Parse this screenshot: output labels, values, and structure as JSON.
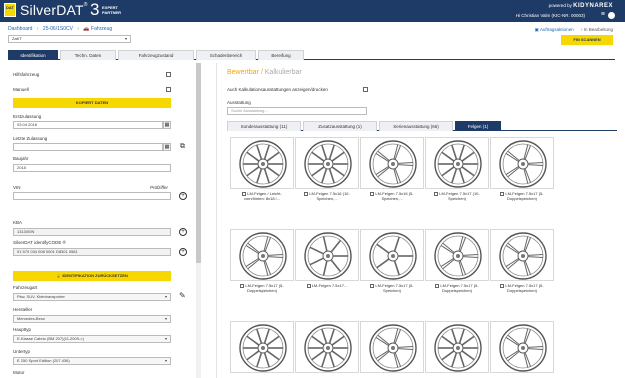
{
  "header": {
    "brand": "SilverDAT",
    "brand_reg": "®",
    "version": "3",
    "expert_line1": "EXPERT",
    "expert_line2": "PARTNER",
    "logo_text": "DAT",
    "powered_by": "powered by",
    "powered_brand": "KIDYNAREX",
    "user": "Hi Christian Valm (KIC-NR. 00003)"
  },
  "breadcrumb": {
    "items": [
      "Dashboard",
      "25-06/1S0CV",
      "Fahrzeug"
    ]
  },
  "actions": {
    "orders": "Auftragsaktionen",
    "state": "In Bearbeitung",
    "scan_button": "FIN SCANNEN"
  },
  "top_select": {
    "value": "ZaKT"
  },
  "tabs": [
    "Identifikation",
    "Techn. Daten",
    "Fahrzeugzustand",
    "Schadenbereich",
    "Bereifung"
  ],
  "left": {
    "hilfsfahrzeug": "Hilfsfahrzeug",
    "manuell": "Manuell",
    "kopiert_button": "KOPIERT DATEN",
    "erstzulassung_label": "Erstzulassung",
    "erstzulassung_value": "03.04.2018",
    "letzte_label": "Letzte Zulassung",
    "letzte_value": "",
    "baujahr_label": "Baujahr",
    "baujahr_value": "2018",
    "vin_label": "VIN",
    "pruefziffer_label": "Prüfziffer",
    "kba_label": "KBA",
    "kba_value": "1313/00N",
    "silverdat_label": "SilverDAT identifyCODE ®",
    "silverdat_value": "01 570 034 008 0001 D8301 0581",
    "ident_button": "IDENTIFIKATION ZURÜCKSETZEN",
    "fahrzeugart_label": "Fahrzeugart",
    "fahrzeugart_value": "Pkw, SUV, Kleintransporter",
    "hersteller_label": "Hersteller",
    "hersteller_value": "Mercedes-Benz",
    "haupttyp_label": "Haupttyp",
    "haupttyp_value": "E-Klasse Cabrio (BM 207)(11.2009->)",
    "untertyp_label": "Untertyp",
    "untertyp_value": "E 250 Sport Edition (207.436)",
    "motor_label": "Motor"
  },
  "right": {
    "title_active": "Bewertbar",
    "title_sep": "/",
    "title_inactive": "Kalkulierbar",
    "all_equip_label": "Auch Kalkulationsausstattungen anzeigen/drucken",
    "ausstattung_label": "Ausstattung",
    "search_placeholder": "Suche Ausstattung...",
    "subtabs": [
      "Sonderausstattung (11)",
      "Zusatzausstattung (1)",
      "Serienausstattung (66)",
      "Felgen (1)"
    ],
    "wheels": [
      {
        "label": "LM-Felgen / Leicht-",
        "label2": "vorn/hinten: 8x18 /..."
      },
      {
        "label": "LM-Felgen 7.5x16 (10-",
        "label2": "Speichen,..."
      },
      {
        "label": "LM-Felgen 7.5x16 (5-",
        "label2": "Speichen,..."
      },
      {
        "label": "LM-Felgen 7.5x17 (10-",
        "label2": "Speichen)"
      },
      {
        "label": "LM-Felgen 7.5x17 (5-",
        "label2": "Doppelspeichen)"
      },
      {
        "label": "LM-Felgen 7.5x17 (5-",
        "label2": "Doppelspeichen)"
      },
      {
        "label": "LM-Felgen 7.5x17...",
        "label2": ""
      },
      {
        "label": "LM-Felgen 7.5x17 (5-",
        "label2": "Speichen)"
      },
      {
        "label": "LM-Felgen 7.5x17 (5-",
        "label2": "Doppelspeichen)"
      },
      {
        "label": "LM-Felgen 7.5x17 (5-",
        "label2": "Doppelspeichen)"
      },
      {
        "label": "",
        "label2": ""
      },
      {
        "label": "",
        "label2": ""
      },
      {
        "label": "",
        "label2": ""
      },
      {
        "label": "",
        "label2": ""
      },
      {
        "label": "",
        "label2": ""
      }
    ]
  },
  "colors": {
    "header_bg": "#1e3a66",
    "accent_yellow": "#f6d700",
    "title_orange": "#f0a800"
  }
}
